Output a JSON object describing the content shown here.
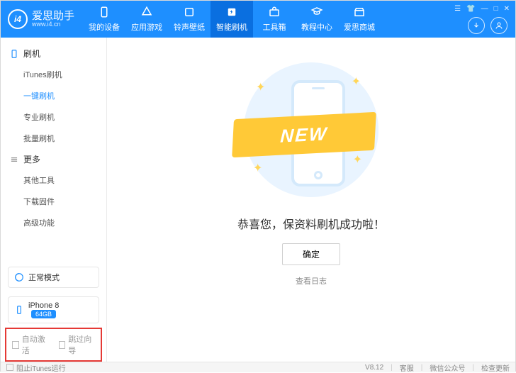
{
  "app": {
    "name": "爱思助手",
    "url": "www.i4.cn",
    "badge": "i4"
  },
  "nav": [
    {
      "label": "我的设备"
    },
    {
      "label": "应用游戏"
    },
    {
      "label": "铃声壁纸"
    },
    {
      "label": "智能刷机"
    },
    {
      "label": "工具箱"
    },
    {
      "label": "教程中心"
    },
    {
      "label": "爱思商城"
    }
  ],
  "sidebar": {
    "section1": {
      "title": "刷机",
      "items": [
        "iTunes刷机",
        "一键刷机",
        "专业刷机",
        "批量刷机"
      ]
    },
    "section2": {
      "title": "更多",
      "items": [
        "其他工具",
        "下载固件",
        "高级功能"
      ]
    }
  },
  "mode": {
    "label": "正常模式"
  },
  "device": {
    "name": "iPhone 8",
    "storage": "64GB"
  },
  "options": {
    "auto_activate": "自动激活",
    "skip_guide": "跳过向导"
  },
  "main": {
    "ribbon": "NEW",
    "headline": "恭喜您，保资料刷机成功啦！",
    "confirm": "确定",
    "view_log": "查看日志"
  },
  "footer": {
    "block_itunes": "阻止iTunes运行",
    "version": "V8.12",
    "support": "客服",
    "wechat": "微信公众号",
    "update": "检查更新"
  }
}
